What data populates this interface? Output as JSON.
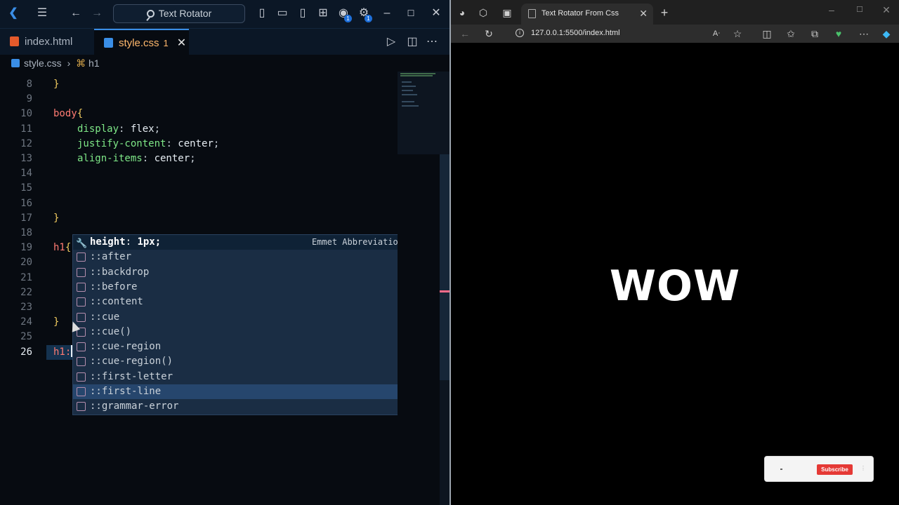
{
  "vscode": {
    "search_label": "Text Rotator",
    "badge_count_1": "1",
    "badge_count_2": "1",
    "tabs": [
      {
        "label": "index.html",
        "active": false
      },
      {
        "label": "style.css",
        "active": true,
        "problems": "1"
      }
    ],
    "breadcrumb": {
      "file": "style.css",
      "symbol": "h1"
    },
    "lines": [
      {
        "num": "8",
        "text": "}"
      },
      {
        "num": "9",
        "text": ""
      },
      {
        "num": "10",
        "selector": "body",
        "brace": "{"
      },
      {
        "num": "11",
        "prop": "display",
        "value": "flex"
      },
      {
        "num": "12",
        "prop": "justify-content",
        "value": "center"
      },
      {
        "num": "13",
        "prop": "align-items",
        "value": "center"
      },
      {
        "num": "14",
        "text": ""
      },
      {
        "num": "15",
        "text": ""
      },
      {
        "num": "16",
        "text": ""
      },
      {
        "num": "17",
        "text": "}"
      },
      {
        "num": "18",
        "text": ""
      },
      {
        "num": "19",
        "selector": "h1",
        "brace": "{"
      },
      {
        "num": "20",
        "text": ""
      },
      {
        "num": "21",
        "text": ""
      },
      {
        "num": "22",
        "text": ""
      },
      {
        "num": "23",
        "text": ""
      },
      {
        "num": "24",
        "text": "}"
      },
      {
        "num": "25",
        "text": ""
      },
      {
        "num": "26",
        "text": "h1:"
      }
    ],
    "suggest": {
      "first": {
        "name": "height",
        "value": "1px;",
        "detail": "Emmet Abbreviation"
      },
      "items": [
        "::after",
        "::backdrop",
        "::before",
        "::content",
        "::cue",
        "::cue()",
        "::cue-region",
        "::cue-region()",
        "::first-letter",
        "::first-line",
        "::grammar-error"
      ],
      "highlighted_index": 9
    }
  },
  "browser": {
    "tab_title": "Text Rotator From Css",
    "url": "127.0.0.1:5500/index.html",
    "page_text": "WOW",
    "subscribe_label": "Subscribe"
  }
}
